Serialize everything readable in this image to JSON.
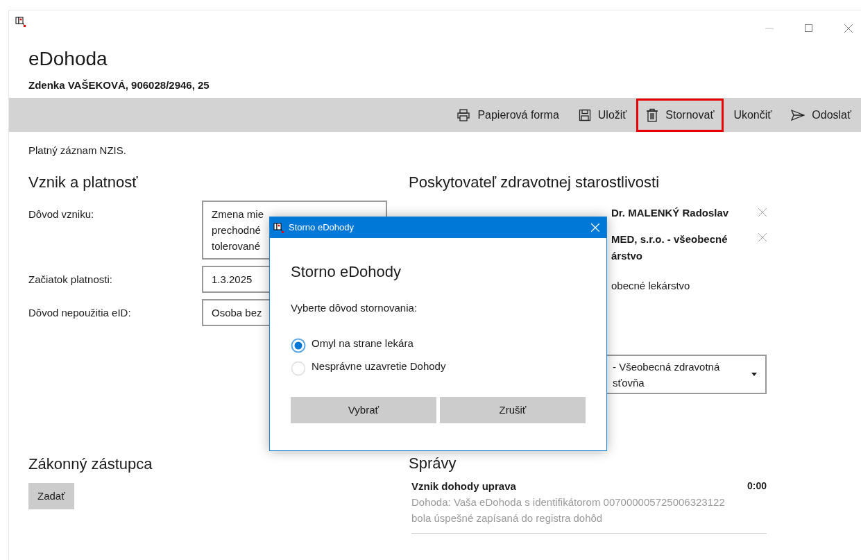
{
  "window": {
    "app_title": "eDohoda",
    "patient": "Zdenka VAŠEKOVÁ, 906028/2946, 25"
  },
  "toolbar": [
    {
      "kind": "print",
      "label": "Papierová forma",
      "highlighted": false
    },
    {
      "kind": "save",
      "label": "Uložiť",
      "highlighted": false
    },
    {
      "kind": "delete",
      "label": "Stornovať",
      "highlighted": true
    },
    {
      "kind": "plain",
      "label": "Ukončiť",
      "highlighted": false
    },
    {
      "kind": "send",
      "label": "Odoslať",
      "highlighted": false
    }
  ],
  "status": "Platný záznam NZIS.",
  "origin": {
    "heading": "Vznik a platnosť",
    "fields": [
      {
        "label": "Dôvod vzniku:",
        "lines": [
          "Zmena mie",
          "prechodné",
          "tolerované"
        ]
      },
      {
        "label": "Začiatok platnosti:",
        "lines": [
          "1.3.2025"
        ]
      },
      {
        "label": "Dôvod nepoužitia eID:",
        "lines": [
          "Osoba bez"
        ]
      }
    ]
  },
  "provider": {
    "heading": "Poskytovateľ zdravotnej starostlivosti",
    "doctor": "Dr. MALENKÝ Radoslav",
    "facility": [
      "MED, s.r.o. - všeobecné",
      "árstvo"
    ],
    "specialty": "obecné lekárstvo",
    "insurer": [
      "- Všeobecná zdravotná",
      "sťovňa"
    ]
  },
  "representative": {
    "heading": "Zákonný zástupca",
    "button": "Zadať"
  },
  "messages": {
    "heading": "Správy",
    "items": [
      {
        "title": "Vznik dohody uprava",
        "time": "0:00",
        "body": "Dohoda: Vaša eDohoda s identifikátorom 007000005725006323122 bola úspešné zapísaná do registra dohôd"
      }
    ]
  },
  "dialog": {
    "title": "Storno eDohody",
    "heading": "Storno eDohody",
    "prompt": "Vyberte dôvod stornovania:",
    "options": [
      {
        "label": "Omyl na strane lekára",
        "selected": true
      },
      {
        "label": "Nesprávne uzavretie Dohody",
        "selected": false
      }
    ],
    "buttons": [
      "Vybrať",
      "Zrušiť"
    ]
  }
}
